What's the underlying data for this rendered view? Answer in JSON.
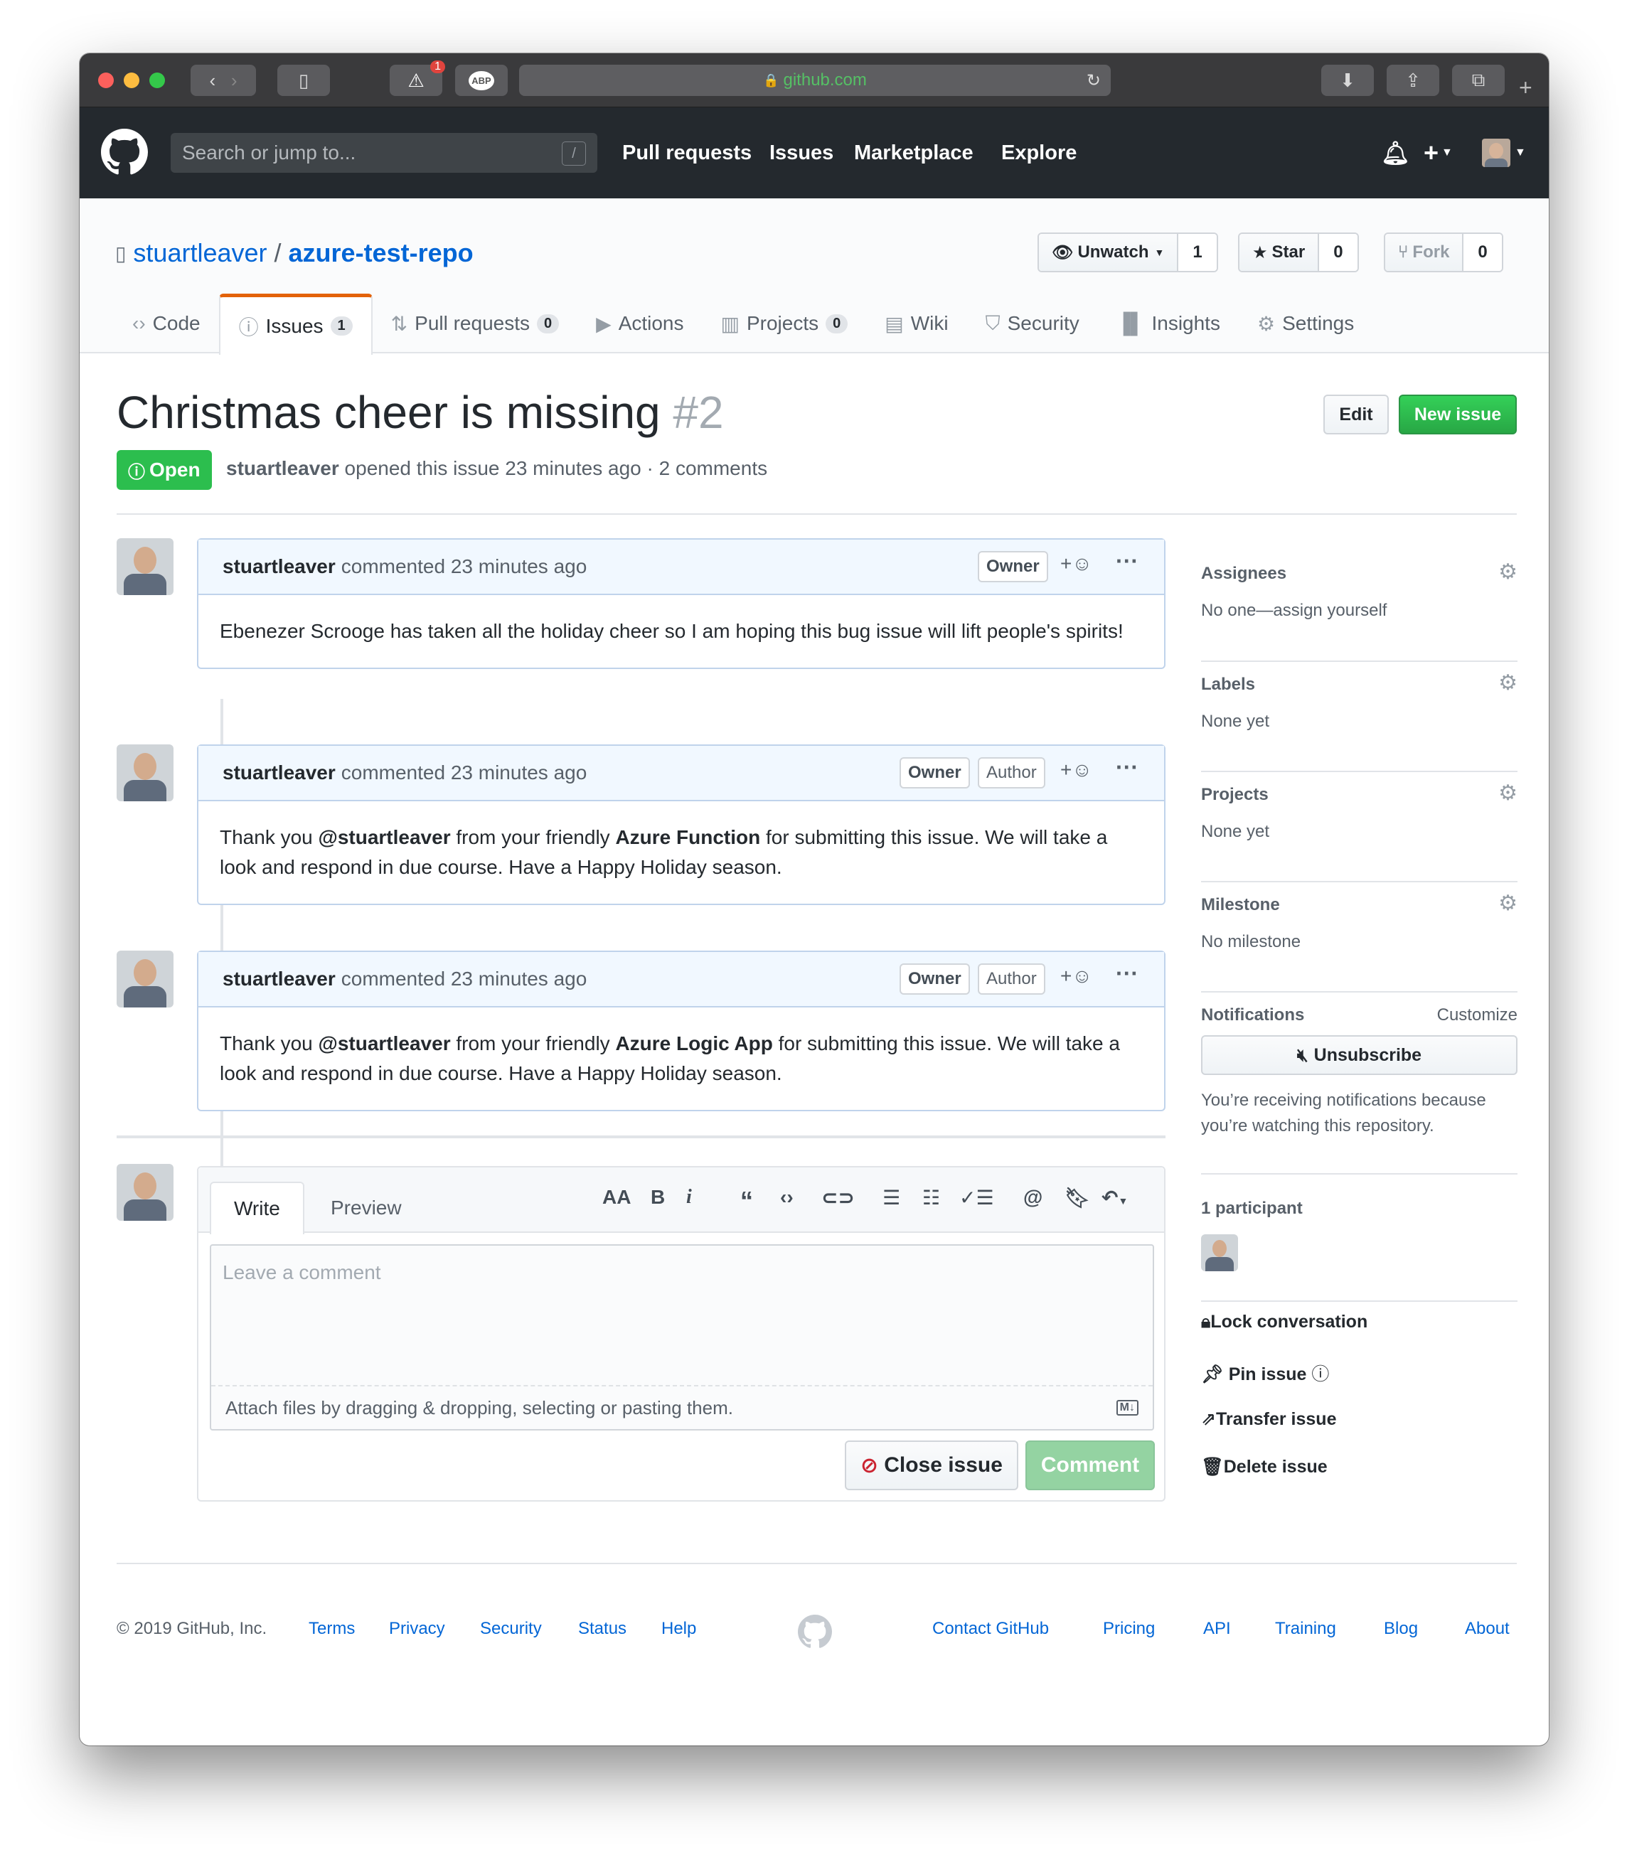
{
  "browser": {
    "url": "github.com",
    "notif_count": "1",
    "abp_label": "ABP"
  },
  "gh": {
    "search_placeholder": "Search or jump to...",
    "slash": "/",
    "nav": [
      "Pull requests",
      "Issues",
      "Marketplace",
      "Explore"
    ]
  },
  "repo": {
    "owner": "stuartleaver",
    "sep": "/",
    "name": "azure-test-repo",
    "unwatch": "Unwatch",
    "watch_count": "1",
    "star": "Star",
    "star_count": "0",
    "fork": "Fork",
    "fork_count": "0",
    "tabs": [
      {
        "label": "Code"
      },
      {
        "label": "Issues",
        "count": "1"
      },
      {
        "label": "Pull requests",
        "count": "0"
      },
      {
        "label": "Actions"
      },
      {
        "label": "Projects",
        "count": "0"
      },
      {
        "label": "Wiki"
      },
      {
        "label": "Security"
      },
      {
        "label": "Insights"
      },
      {
        "label": "Settings"
      }
    ]
  },
  "issue": {
    "title": "Christmas cheer is missing",
    "number": "#2",
    "edit": "Edit",
    "new_issue": "New issue",
    "state": "Open",
    "author": "stuartleaver",
    "meta": "opened this issue 23 minutes ago · 2 comments"
  },
  "comments": [
    {
      "author": "stuartleaver",
      "time": "commented 23 minutes ago",
      "owner": "Owner",
      "body": "Ebenezer Scrooge has taken all the holiday cheer so I am hoping this bug issue will lift people's spirits!"
    },
    {
      "author": "stuartleaver",
      "time": "commented 23 minutes ago",
      "owner": "Owner",
      "role": "Author",
      "pre": "Thank you ",
      "mention": "@stuartleaver",
      "mid": " from your friendly ",
      "bold": "Azure Function",
      "post": " for submitting this issue. We will take a look and respond in due course. Have a Happy Holiday season."
    },
    {
      "author": "stuartleaver",
      "time": "commented 23 minutes ago",
      "owner": "Owner",
      "role": "Author",
      "pre": "Thank you ",
      "mention": "@stuartleaver",
      "mid": " from your friendly ",
      "bold": "Azure Logic App",
      "post": " for submitting this issue. We will take a look and respond in due course. Have a Happy Holiday season."
    }
  ],
  "editor": {
    "write": "Write",
    "preview": "Preview",
    "placeholder": "Leave a comment",
    "attach": "Attach files by dragging & dropping, selecting or pasting them.",
    "close": "Close issue",
    "comment": "Comment"
  },
  "sidebar": {
    "assignees": "Assignees",
    "assignees_val": "No one—assign yourself",
    "labels": "Labels",
    "labels_val": "None yet",
    "projects": "Projects",
    "projects_val": "None yet",
    "milestone": "Milestone",
    "milestone_val": "No milestone",
    "notifications": "Notifications",
    "customize": "Customize",
    "unsubscribe": "Unsubscribe",
    "notif_reason": "You’re receiving notifications because you’re watching this repository.",
    "participants": "1 participant",
    "lock": "Lock conversation",
    "pin": "Pin issue",
    "transfer": "Transfer issue",
    "delete": "Delete issue"
  },
  "footer": {
    "copyright": "© 2019 GitHub, Inc.",
    "left": [
      "Terms",
      "Privacy",
      "Security",
      "Status",
      "Help"
    ],
    "right": [
      "Contact GitHub",
      "Pricing",
      "API",
      "Training",
      "Blog",
      "About"
    ]
  },
  "colors": {
    "accent": "#0366d6",
    "open": "#2cbe4e",
    "nav_bg": "#24292e",
    "tab_active": "#e36209"
  }
}
